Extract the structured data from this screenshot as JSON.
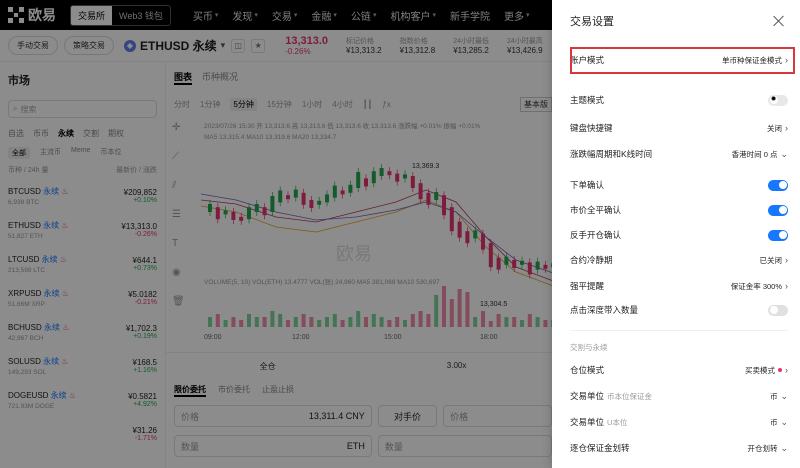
{
  "nav": {
    "brand": "欧易",
    "seg": [
      "交易所",
      "Web3 钱包"
    ],
    "items": [
      "买币",
      "发现",
      "交易",
      "金融",
      "公链",
      "机构客户",
      "新手学院",
      "更多"
    ]
  },
  "ticker": {
    "btn_manual": "手动交易",
    "btn_strategy": "策略交易",
    "symbol": "ETHUSD 永续",
    "coin_glyph": "◆",
    "price": "13,313.0",
    "change": "-0.26%",
    "stats": [
      {
        "label": "标记价格",
        "value": "¥13,313.2"
      },
      {
        "label": "指数价格",
        "value": "¥13,312.8"
      },
      {
        "label": "24小时最低",
        "value": "¥13,285.2"
      },
      {
        "label": "24小时最高",
        "value": "¥13,426.9"
      }
    ]
  },
  "market": {
    "title": "市场",
    "search_placeholder": "搜索",
    "tabs": [
      "自选",
      "币币",
      "永续",
      "交割",
      "期权"
    ],
    "chips": [
      "全部",
      "主流币",
      "Meme",
      "币本位"
    ],
    "head_left": "币种 / 24h 量",
    "head_right": "最新价 / 涨跌",
    "rows": [
      {
        "name": "BTCUSD",
        "tag": "永续",
        "vol": "6,938 BTC",
        "price": "¥209,852",
        "chg": "+0.10%",
        "dir": "up"
      },
      {
        "name": "ETHUSD",
        "tag": "永续",
        "vol": "51,827 ETH",
        "price": "¥13,313.0",
        "chg": "-0.26%",
        "dir": "dn"
      },
      {
        "name": "LTCUSD",
        "tag": "永续",
        "vol": "213,598 LTC",
        "price": "¥644.1",
        "chg": "+0.73%",
        "dir": "up"
      },
      {
        "name": "XRPUSD",
        "tag": "永续",
        "vol": "51.66M XRP",
        "price": "¥5.0182",
        "chg": "-0.21%",
        "dir": "dn"
      },
      {
        "name": "BCHUSD",
        "tag": "永续",
        "vol": "42,967 BCH",
        "price": "¥1,702.3",
        "chg": "+0.19%",
        "dir": "up"
      },
      {
        "name": "SOLUSD",
        "tag": "永续",
        "vol": "149,293 SOL",
        "price": "¥168.5",
        "chg": "+1.16%",
        "dir": "up"
      },
      {
        "name": "DOGEUSD",
        "tag": "永续",
        "vol": "721.93M DOGE",
        "price": "¥0.5821",
        "chg": "+4.92%",
        "dir": "up"
      },
      {
        "name": "",
        "tag": "",
        "vol": "",
        "price": "¥31.26",
        "chg": "-1.71%",
        "dir": "dn"
      }
    ]
  },
  "chart": {
    "tabs": [
      "图表",
      "币种概况"
    ],
    "timeframes": [
      "分时",
      "1分钟",
      "5分钟",
      "15分钟",
      "1小时",
      "4小时"
    ],
    "active_tf": "5分钟",
    "right_label": "基本版",
    "ohlc": "2023/07/26 15:30  开 13,313.6  高 13,313.6  低 13,313.6  收 13,313.6  涨跌幅 +0.01%  振幅 +0.01%",
    "ma": "MA5 13,315.4   MA10 13,319.6   MA20 13,334.7",
    "high_label": "13,369.3",
    "low_label": "13,304.5",
    "vol_title": "VOLUME(5, 10)  VOL(ETH)  13.4777   VOL(张)  24,960   MA5  381,068   MA10  530,697",
    "times": [
      "09:00",
      "12:00",
      "15:00",
      "18:00"
    ],
    "watermark": "欧易"
  },
  "order": {
    "margin_mode": "全仓",
    "leverage": "3.00x",
    "tabs": [
      "限价委托",
      "市价委托",
      "止盈止损"
    ],
    "price_label": "价格",
    "price_value": "13,311.4",
    "price_unit": "CNY",
    "counter_btn": "对手价",
    "qty_label": "数量",
    "qty_unit": "ETH"
  },
  "drawer": {
    "title": "交易设置",
    "account_mode_label": "账户模式",
    "account_mode_value": "单币种保证金模式",
    "theme_label": "主题模式",
    "hotkey_label": "键盘快捷键",
    "hotkey_value": "关闭",
    "period_label": "涨跌幅周期和K线时间",
    "period_value": "香港时间 0 点",
    "confirm_order": "下单确认",
    "confirm_market_close": "市价全平确认",
    "confirm_reverse": "反手开仓确认",
    "cooldown_label": "合约冷静期",
    "cooldown_value": "已关闭",
    "liq_label": "强平提醒",
    "liq_value": "保证金率 300%",
    "depth_label": "点击深度带入数量",
    "section_title": "交割与永续",
    "position_mode_label": "仓位模式",
    "position_mode_value": "买卖模式",
    "unit1_label": "交易单位",
    "unit1_hint": "币本位保证金",
    "unit1_value": "币",
    "unit2_label": "交易单位",
    "unit2_hint": "U本位",
    "unit2_value": "币",
    "auto_margin_label": "逐仓保证金划转",
    "auto_margin_value": "开仓划转"
  }
}
